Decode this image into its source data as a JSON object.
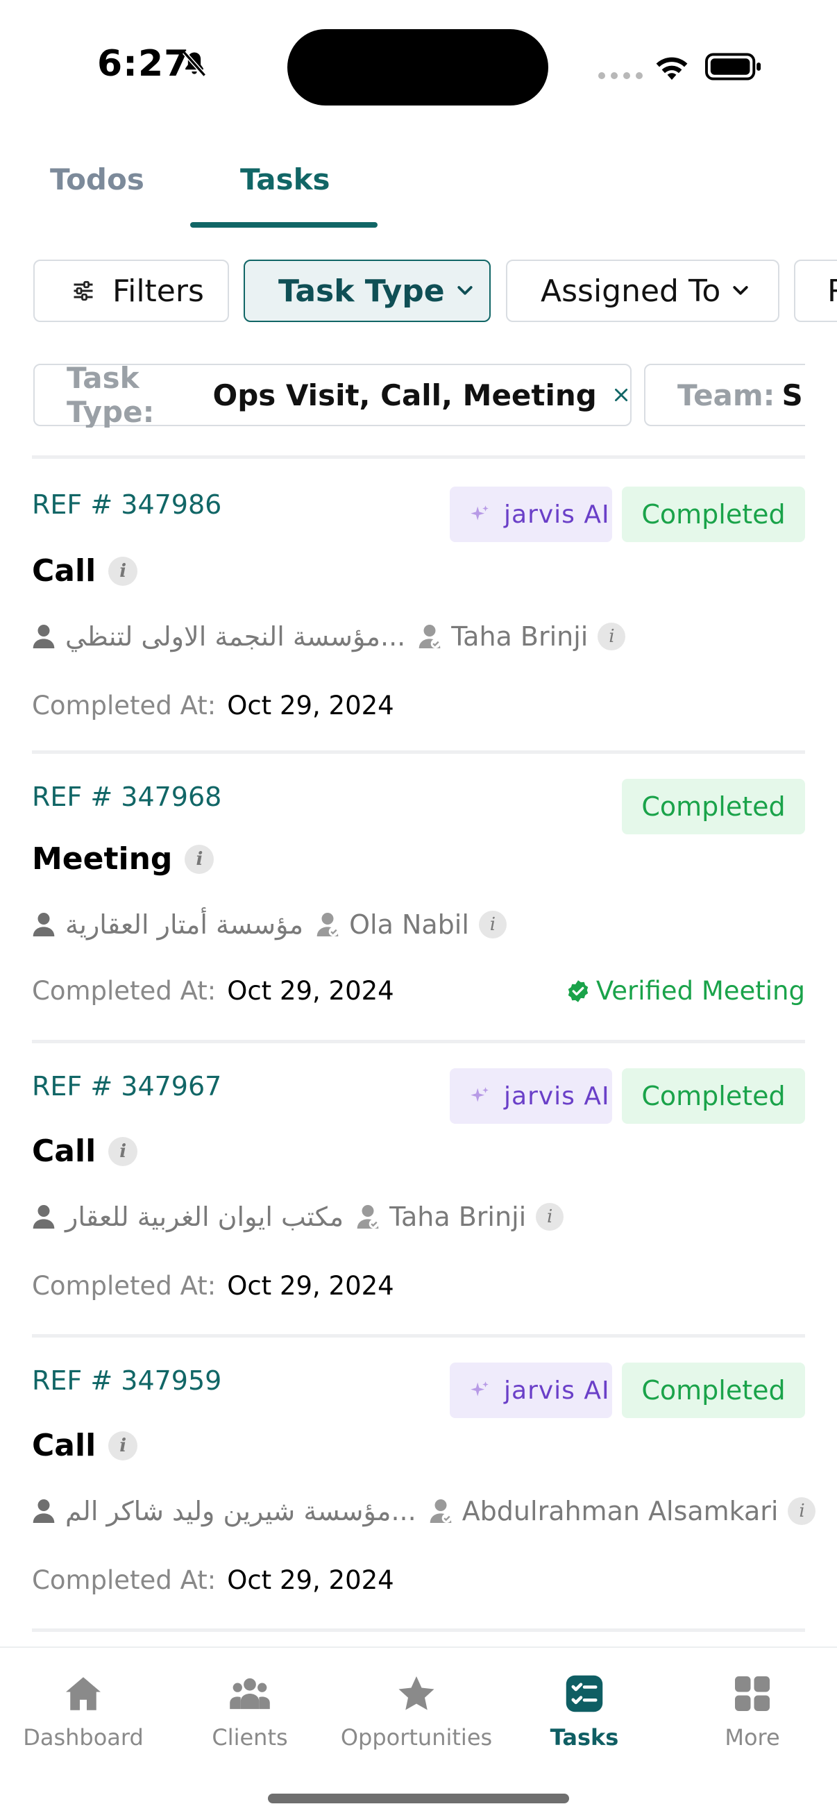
{
  "status_bar": {
    "time": "6:27"
  },
  "tabs": [
    {
      "label": "Todos",
      "active": false
    },
    {
      "label": "Tasks",
      "active": true
    }
  ],
  "filters": {
    "filters_label": "Filters",
    "task_type_label": "Task Type",
    "assigned_to_label": "Assigned To",
    "more_label": "R"
  },
  "active_filters": [
    {
      "key": "Task Type:",
      "value": "Ops Visit, Call, Meeting"
    },
    {
      "key": "Team:",
      "value": "Sm"
    }
  ],
  "tasks": [
    {
      "ref": "REF # 347986",
      "type": "Call",
      "client": "مؤسسة النجمة الاولى لتنظي...",
      "assignee": "Taha Brinji",
      "completed_label": "Completed At:",
      "completed_date": "Oct 29, 2024",
      "status": "Completed",
      "jarvis_label": "jarvis AI"
    },
    {
      "ref": "REF # 347968",
      "type": "Meeting",
      "client": "مؤسسة أمتار العقارية",
      "assignee": "Ola Nabil",
      "completed_label": "Completed At:",
      "completed_date": "Oct 29, 2024",
      "status": "Completed",
      "verified_label": "Verified Meeting"
    },
    {
      "ref": "REF # 347967",
      "type": "Call",
      "client": "مكتب ايوان الغربية للعقار",
      "assignee": "Taha Brinji",
      "completed_label": "Completed At:",
      "completed_date": "Oct 29, 2024",
      "status": "Completed",
      "jarvis_label": "jarvis AI"
    },
    {
      "ref": "REF # 347959",
      "type": "Call",
      "client": "مؤسسة شيرين وليد شاكر الم...",
      "assignee": "Abdulrahman Alsamkari",
      "completed_label": "Completed At:",
      "completed_date": "Oct 29, 2024",
      "status": "Completed",
      "jarvis_label": "jarvis AI"
    }
  ],
  "bottom_nav": [
    {
      "label": "Dashboard",
      "icon": "home-icon",
      "active": false
    },
    {
      "label": "Clients",
      "icon": "people-icon",
      "active": false
    },
    {
      "label": "Opportunities",
      "icon": "star-icon",
      "active": false
    },
    {
      "label": "Tasks",
      "icon": "tasks-icon",
      "active": true
    },
    {
      "label": "More",
      "icon": "grid-icon",
      "active": false
    }
  ],
  "colors": {
    "primary": "#116666",
    "success": "#1aa34a",
    "jarvis": "#6a3fc8"
  }
}
